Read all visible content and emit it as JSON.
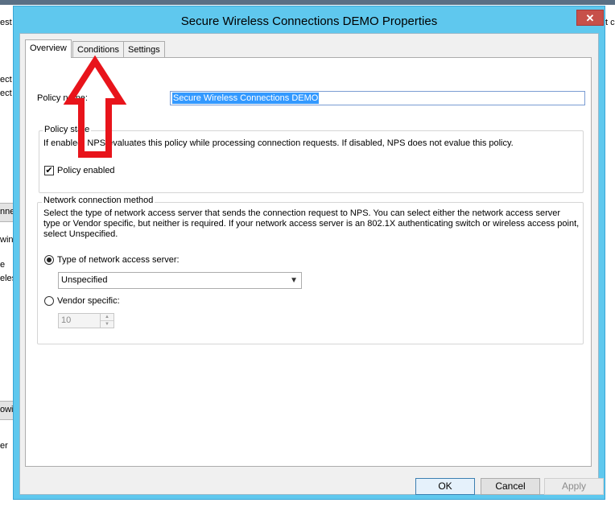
{
  "background": {
    "fragments": [
      "est",
      "ect",
      "ect",
      "nned",
      "wing",
      "e",
      "eless",
      "owin",
      "er"
    ],
    "right_fragment": "t c"
  },
  "dialog": {
    "title": "Secure Wireless Connections DEMO Properties",
    "close_glyph": "✕",
    "tabs": [
      {
        "label": "Overview",
        "active": true
      },
      {
        "label": "Conditions",
        "active": false
      },
      {
        "label": "Settings",
        "active": false
      }
    ],
    "policy_name_label": "Policy name:",
    "policy_name_value": "Secure Wireless Connections DEMO",
    "policy_state": {
      "title": "Policy state",
      "description": "If enabled, NPS evaluates this policy while processing connection requests. If disabled, NPS does not evalue this policy.",
      "checkbox_label": "Policy enabled",
      "checked": true
    },
    "network_method": {
      "title": "Network connection method",
      "description_line1": "Select the type of network access server that sends the connection request to NPS. You can select either the network access server",
      "description_line2": "type or Vendor specific, but neither is required.  If your network access server is an 802.1X authenticating switch or wireless access point,",
      "description_line3": "select Unspecified.",
      "type_radio_label": "Type of network access server:",
      "type_selected": true,
      "type_value": "Unspecified",
      "vendor_radio_label": "Vendor specific:",
      "vendor_selected": false,
      "vendor_value": "10"
    },
    "buttons": {
      "ok": "OK",
      "cancel": "Cancel",
      "apply": "Apply"
    }
  },
  "annotation": {
    "color": "#e8141b",
    "icon": "red-up-arrow-icon"
  }
}
